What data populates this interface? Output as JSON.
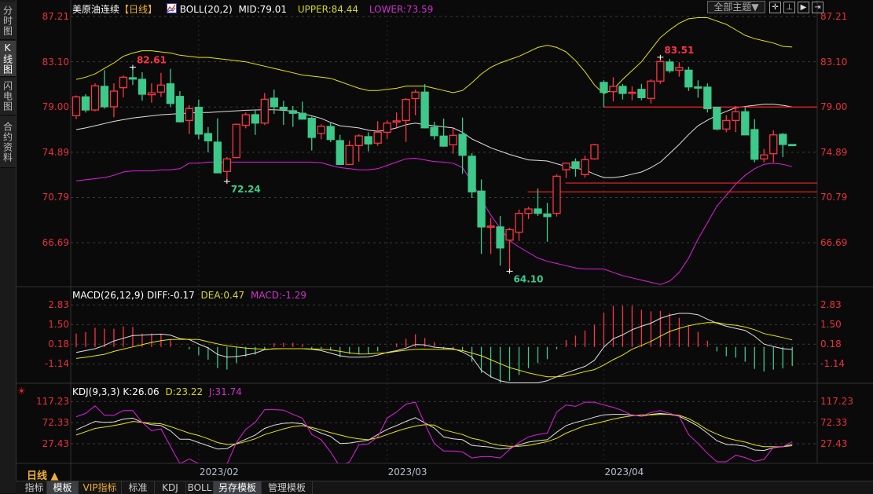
{
  "sidebar": {
    "tabs": [
      {
        "label": "分时图"
      },
      {
        "label": "K线图"
      },
      {
        "label": "闪电图"
      },
      {
        "label": "合约资料"
      }
    ]
  },
  "header": {
    "instrument": "美原油连续",
    "period_bracket_l": "【",
    "period": "日线",
    "period_bracket_r": "】",
    "boll_name": "BOLL(20,2)",
    "mid": "MID:79.01",
    "upper": "UPPER:84.44",
    "lower": "LOWER:73.59"
  },
  "toolbar": {
    "theme_select": "全部主题▼",
    "icons": [
      "crosshair-icon",
      "zoom-range-icon",
      "play-forward-icon",
      "move-right-icon"
    ]
  },
  "macd_header": {
    "name": "MACD(26,12,9)",
    "diff": "DIFF:-0.17",
    "dea": "DEA:0.47",
    "macd": "MACD:-1.29"
  },
  "kdj_header": {
    "name": "KDJ(9,3,3)",
    "k": "K:26.06",
    "d": "D:23.22",
    "j": "J:31.74"
  },
  "period_selector": "日线 ▲",
  "bottom_tabs": [
    {
      "label": "指标"
    },
    {
      "label": "模板"
    },
    {
      "label": "VIP指标"
    },
    {
      "label": "标准"
    },
    {
      "label": "KDJ"
    },
    {
      "label": "BOLL"
    },
    {
      "label": "另存模板"
    },
    {
      "label": "管理模板"
    }
  ],
  "colors": {
    "up": "#ff3344",
    "down": "#3cc98a",
    "axis": "#e8303c",
    "yellow": "#e6e600",
    "white": "#e0e0e0",
    "magenta": "#e020e0",
    "line": "#ff2020"
  },
  "chart_data": [
    {
      "type": "candlestick",
      "title": "美原油连续 日线 BOLL(20,2)",
      "yticks": [
        "87.21",
        "83.10",
        "79.00",
        "74.89",
        "70.79",
        "66.69"
      ],
      "ylim": [
        62.6,
        88.7
      ],
      "x_labels": [
        {
          "label": "2023/02",
          "candle": 13
        },
        {
          "label": "2023/03",
          "candle": 33
        },
        {
          "label": "2023/04",
          "candle": 56
        }
      ],
      "ohlc": [
        [
          78.21,
          80.04,
          77.9,
          79.92
        ],
        [
          79.92,
          80.16,
          78.5,
          78.73
        ],
        [
          78.73,
          81.15,
          78.61,
          80.92
        ],
        [
          80.87,
          82.34,
          78.85,
          79.02
        ],
        [
          79.02,
          81.15,
          78.07,
          80.44
        ],
        [
          80.75,
          81.87,
          79.87,
          81.7
        ],
        [
          81.65,
          82.61,
          80.99,
          81.53
        ],
        [
          81.51,
          82.15,
          79.56,
          80.16
        ],
        [
          80.11,
          81.15,
          79.39,
          80.28
        ],
        [
          80.35,
          82.1,
          79.92,
          80.99
        ],
        [
          81.1,
          82.46,
          79.02,
          79.32
        ],
        [
          79.96,
          80.44,
          77.59,
          77.66
        ],
        [
          77.78,
          79.16,
          76.54,
          78.85
        ],
        [
          78.97,
          79.68,
          76.07,
          76.54
        ],
        [
          76.59,
          77.18,
          74.88,
          75.93
        ],
        [
          75.81,
          77.97,
          73.03,
          73.03
        ],
        [
          73.15,
          74.46,
          72.24,
          74.29
        ],
        [
          74.41,
          77.5,
          74.34,
          77.43
        ],
        [
          77.33,
          78.5,
          77.07,
          78.3
        ],
        [
          78.3,
          78.73,
          76.47,
          77.54
        ],
        [
          77.54,
          80.28,
          77.36,
          79.7
        ],
        [
          79.8,
          80.58,
          78.37,
          79.02
        ],
        [
          78.97,
          79.56,
          77.38,
          78.78
        ],
        [
          78.66,
          79.09,
          77.19,
          78.43
        ],
        [
          78.43,
          79.49,
          77.88,
          77.9
        ],
        [
          77.97,
          78.14,
          75.05,
          76.24
        ],
        [
          76.6,
          77.43,
          76.07,
          77.26
        ],
        [
          77.23,
          77.59,
          75.81,
          76.05
        ],
        [
          75.95,
          76.47,
          73.79,
          73.79
        ],
        [
          73.79,
          75.95,
          73.79,
          75.5
        ],
        [
          75.5,
          76.52,
          74.05,
          76.38
        ],
        [
          76.31,
          76.71,
          74.98,
          75.65
        ],
        [
          75.72,
          77.71,
          75.48,
          76.71
        ],
        [
          76.71,
          77.78,
          76.12,
          77.54
        ],
        [
          77.66,
          78.5,
          77.14,
          77.74
        ],
        [
          77.78,
          79.8,
          75.83,
          79.68
        ],
        [
          79.77,
          80.58,
          78.25,
          80.35
        ],
        [
          80.35,
          81.08,
          77.07,
          77.11
        ],
        [
          77.16,
          77.66,
          76.05,
          76.4
        ],
        [
          76.36,
          77.95,
          75.4,
          75.45
        ],
        [
          75.57,
          77.07,
          74.76,
          76.43
        ],
        [
          76.52,
          78.04,
          72.94,
          74.62
        ],
        [
          74.53,
          74.81,
          70.75,
          71.3
        ],
        [
          71.37,
          72.43,
          65.67,
          68.12
        ],
        [
          68.1,
          68.94,
          65.67,
          68.2
        ],
        [
          68.12,
          69.11,
          64.61,
          66.21
        ],
        [
          66.92,
          68.04,
          64.1,
          67.87
        ],
        [
          67.64,
          69.7,
          66.85,
          69.35
        ],
        [
          69.35,
          69.94,
          68.83,
          69.75
        ],
        [
          69.75,
          71.6,
          69.11,
          69.35
        ],
        [
          69.3,
          70.3,
          66.78,
          69.06
        ],
        [
          69.35,
          72.91,
          69.06,
          72.72
        ],
        [
          73.31,
          73.86,
          72.55,
          73.9
        ],
        [
          74.03,
          74.34,
          72.68,
          73.43
        ],
        [
          72.87,
          74.58,
          72.6,
          74.22
        ],
        [
          74.29,
          75.65,
          74.22,
          75.57
        ],
        [
          81.23,
          81.42,
          78.97,
          80.32
        ],
        [
          80.39,
          81.7,
          79.51,
          80.87
        ],
        [
          80.87,
          81.1,
          79.68,
          80.23
        ],
        [
          80.3,
          80.87,
          79.61,
          80.34
        ],
        [
          80.6,
          81.1,
          79.61,
          79.85
        ],
        [
          79.78,
          81.51,
          79.32,
          81.35
        ],
        [
          81.35,
          83.51,
          81.1,
          83.13
        ],
        [
          83.08,
          83.36,
          82.1,
          82.29
        ],
        [
          82.34,
          83.06,
          81.75,
          82.58
        ],
        [
          82.34,
          82.65,
          80.46,
          80.82
        ],
        [
          80.82,
          81.42,
          79.85,
          80.75
        ],
        [
          80.8,
          81.15,
          78.5,
          78.85
        ],
        [
          78.97,
          79.02,
          76.88,
          77.0
        ],
        [
          77.0,
          78.25,
          76.71,
          77.78
        ],
        [
          77.78,
          79.09,
          76.71,
          78.57
        ],
        [
          78.57,
          78.97,
          76.47,
          76.47
        ],
        [
          76.95,
          77.9,
          73.98,
          74.26
        ],
        [
          74.29,
          75.2,
          73.98,
          74.65
        ],
        [
          74.76,
          76.88,
          73.98,
          76.47
        ],
        [
          76.52,
          76.64,
          74.46,
          75.6
        ],
        [
          75.6,
          75.6,
          75.55,
          75.55
        ]
      ],
      "boll_upper": [
        81.5,
        81.7,
        82.0,
        82.5,
        83.0,
        83.6,
        83.9,
        84.1,
        84.1,
        84.0,
        83.9,
        83.7,
        83.6,
        83.5,
        83.5,
        83.4,
        83.3,
        83.2,
        83.1,
        82.9,
        82.7,
        82.5,
        82.3,
        82.1,
        81.9,
        81.8,
        81.7,
        81.6,
        81.3,
        81.0,
        80.7,
        80.5,
        80.5,
        80.6,
        80.7,
        80.9,
        80.9,
        80.9,
        80.7,
        80.5,
        80.3,
        80.5,
        81.2,
        82.0,
        82.6,
        83.0,
        83.3,
        83.6,
        84.0,
        84.4,
        84.6,
        84.4,
        84.0,
        83.2,
        82.2,
        81.0,
        80.2,
        80.6,
        81.5,
        82.3,
        83.1,
        84.2,
        85.3,
        86.0,
        86.6,
        87.0,
        87.1,
        87.1,
        86.8,
        86.5,
        86.0,
        85.5,
        85.2,
        85.0,
        84.8,
        84.5,
        84.44
      ],
      "boll_mid": [
        76.95,
        77.1,
        77.3,
        77.5,
        77.7,
        77.85,
        78.0,
        78.1,
        78.2,
        78.3,
        78.35,
        78.4,
        78.45,
        78.5,
        78.5,
        78.55,
        78.6,
        78.65,
        78.7,
        78.73,
        78.75,
        78.75,
        78.7,
        78.6,
        78.4,
        78.2,
        77.97,
        77.6,
        77.3,
        77.2,
        77.1,
        76.9,
        76.8,
        76.9,
        77.1,
        77.4,
        77.54,
        77.4,
        77.3,
        77.2,
        77.1,
        76.7,
        76.1,
        75.7,
        75.3,
        75.0,
        74.7,
        74.45,
        74.2,
        74.15,
        74.1,
        73.85,
        73.6,
        73.45,
        73.3,
        72.9,
        72.6,
        72.6,
        72.7,
        72.9,
        73.1,
        73.5,
        74.0,
        74.8,
        75.6,
        76.5,
        77.3,
        77.8,
        78.25,
        78.6,
        78.94,
        79.05,
        79.15,
        79.25,
        79.25,
        79.15,
        79.01
      ],
      "boll_lower": [
        72.3,
        72.4,
        72.5,
        72.6,
        72.8,
        73.1,
        73.2,
        73.2,
        73.2,
        73.3,
        73.3,
        73.4,
        73.9,
        73.9,
        74.0,
        74.0,
        74.0,
        74.0,
        74.0,
        74.0,
        74.0,
        74.0,
        74.0,
        74.0,
        74.0,
        74.0,
        73.95,
        73.7,
        73.5,
        73.4,
        73.3,
        73.3,
        73.4,
        73.7,
        74.0,
        74.3,
        74.35,
        74.2,
        74.05,
        74.0,
        73.9,
        73.5,
        72.2,
        70.6,
        69.2,
        68.0,
        66.9,
        66.3,
        65.8,
        65.3,
        65.0,
        64.8,
        64.6,
        64.4,
        64.3,
        64.3,
        64.3,
        64.0,
        63.7,
        63.5,
        63.3,
        63.1,
        62.9,
        63.2,
        64.0,
        65.3,
        67.0,
        68.5,
        70.0,
        71.0,
        72.0,
        72.8,
        73.4,
        73.8,
        73.9,
        73.8,
        73.59
      ],
      "horizontal_lines": [
        {
          "price": 79.0,
          "from_candle": 56
        },
        {
          "price": 72.1,
          "from_candle": 52
        },
        {
          "price": 71.3,
          "from_candle": 48
        }
      ],
      "annotations": [
        {
          "label": "82.61",
          "candle": 6,
          "kind": "high"
        },
        {
          "label": "72.24",
          "candle": 16,
          "kind": "low"
        },
        {
          "label": "64.10",
          "candle": 46,
          "kind": "low"
        },
        {
          "label": "83.51",
          "candle": 62,
          "kind": "high"
        }
      ]
    },
    {
      "type": "bar+line",
      "title": "MACD(26,12,9)",
      "yticks": [
        "2.83",
        "1.50",
        "0.18",
        "-1.14"
      ],
      "macd": [
        0.9,
        1.0,
        1.29,
        1.22,
        1.22,
        1.38,
        1.34,
        0.9,
        0.9,
        0.85,
        0.5,
        0.02,
        -0.16,
        -0.56,
        -0.86,
        -1.43,
        -1.53,
        -1.09,
        -0.65,
        -0.51,
        -0.16,
        0.25,
        0.28,
        0.28,
        0.16,
        -0.16,
        -0.16,
        -0.25,
        -0.69,
        -0.48,
        -0.48,
        -0.48,
        -0.3,
        0.02,
        0.23,
        0.55,
        0.85,
        0.6,
        0.32,
        -0.12,
        -0.1,
        -0.25,
        -1.0,
        -1.75,
        -2.06,
        -2.42,
        -2.28,
        -1.89,
        -1.43,
        -1.09,
        -0.83,
        -0.16,
        0.46,
        0.76,
        1.11,
        1.48,
        2.31,
        2.77,
        2.77,
        2.77,
        2.5,
        2.4,
        2.43,
        2.26,
        1.96,
        1.43,
        1.02,
        0.42,
        -0.3,
        -0.63,
        -0.72,
        -1.0,
        -1.48,
        -1.66,
        -1.53,
        -1.45,
        -1.29
      ],
      "diff": [
        -0.37,
        -0.25,
        -0.12,
        0.1,
        0.4,
        0.58,
        0.76,
        0.79,
        0.83,
        0.86,
        0.79,
        0.56,
        0.49,
        0.19,
        -0.07,
        -0.51,
        -0.69,
        -0.65,
        -0.55,
        -0.42,
        -0.19,
        -0.12,
        -0.12,
        -0.12,
        -0.12,
        -0.16,
        -0.25,
        -0.42,
        -0.6,
        -0.69,
        -0.69,
        -0.67,
        -0.55,
        -0.37,
        -0.25,
        -0.09,
        0.16,
        0.14,
        -0.02,
        -0.07,
        -0.12,
        -0.34,
        -0.69,
        -1.57,
        -2.01,
        -2.28,
        -2.42,
        -2.42,
        -2.42,
        -2.42,
        -2.28,
        -2.01,
        -1.75,
        -1.53,
        -1.31,
        -0.9,
        -0.02,
        0.55,
        0.81,
        1.16,
        1.39,
        1.6,
        1.92,
        2.13,
        2.26,
        2.26,
        2.17,
        1.87,
        1.6,
        1.39,
        1.25,
        1.11,
        0.72,
        0.19,
        0.02,
        -0.12,
        -0.17
      ],
      "dea": [
        -0.78,
        -0.7,
        -0.6,
        -0.5,
        -0.3,
        -0.15,
        0.0,
        0.15,
        0.3,
        0.42,
        0.5,
        0.51,
        0.51,
        0.5,
        0.35,
        0.2,
        0.08,
        0.0,
        -0.08,
        -0.12,
        -0.16,
        -0.14,
        -0.12,
        -0.12,
        -0.12,
        -0.13,
        -0.15,
        -0.2,
        -0.3,
        -0.4,
        -0.48,
        -0.47,
        -0.43,
        -0.4,
        -0.3,
        -0.22,
        -0.16,
        -0.15,
        -0.16,
        -0.16,
        -0.17,
        -0.25,
        -0.42,
        -0.6,
        -0.86,
        -1.13,
        -1.39,
        -1.57,
        -1.75,
        -1.89,
        -2.01,
        -2.01,
        -1.96,
        -1.83,
        -1.66,
        -1.53,
        -1.22,
        -0.86,
        -0.55,
        -0.16,
        0.1,
        0.37,
        0.72,
        1.04,
        1.25,
        1.43,
        1.55,
        1.64,
        1.64,
        1.52,
        1.46,
        1.34,
        1.16,
        0.9,
        0.76,
        0.63,
        0.47
      ]
    },
    {
      "type": "line",
      "title": "KDJ(9,3,3)",
      "yticks": [
        "117.23",
        "72.33",
        "27.43"
      ],
      "k": [
        57,
        66,
        75,
        73,
        74,
        80,
        82,
        73,
        68,
        66,
        55,
        37,
        37,
        30,
        23,
        16,
        17,
        28,
        37,
        46,
        60,
        67,
        71,
        72,
        70,
        59,
        50,
        43,
        28,
        29,
        32,
        35,
        47,
        58,
        66,
        75,
        83,
        72,
        61,
        42,
        38,
        36,
        24,
        22,
        20,
        16,
        18,
        25,
        31,
        34,
        36,
        52,
        66,
        73,
        78,
        84,
        89,
        90,
        90,
        89,
        86,
        90,
        92,
        90,
        86,
        76,
        65,
        50,
        34,
        26,
        25,
        22,
        14,
        13,
        19,
        21,
        26.06
      ],
      "d": [
        46,
        53,
        60,
        63,
        66,
        70,
        75,
        73,
        71,
        70,
        64,
        57,
        50,
        45,
        38,
        30,
        26,
        27,
        32,
        38,
        47,
        53,
        59,
        64,
        66,
        62,
        57,
        51,
        46,
        41,
        38,
        36,
        40,
        47,
        54,
        60,
        65,
        68,
        67,
        57,
        52,
        47,
        39,
        35,
        28,
        24,
        22,
        22,
        24,
        28,
        32,
        39,
        50,
        58,
        66,
        70,
        75,
        80,
        84,
        87,
        89,
        89,
        90,
        90,
        88,
        81,
        70,
        57,
        48,
        40,
        35,
        31,
        25,
        21,
        21,
        21,
        23.22
      ],
      "j": [
        85,
        92,
        108,
        88,
        88,
        98,
        98,
        73,
        55,
        59,
        22,
        -15,
        -5,
        -15,
        -18,
        -24,
        -16,
        30,
        58,
        73,
        100,
        100,
        99,
        90,
        82,
        47,
        36,
        10,
        -22,
        -11,
        25,
        27,
        42,
        82,
        95,
        112,
        116,
        70,
        28,
        12,
        12,
        10,
        -3,
        0,
        0,
        -3,
        15,
        30,
        42,
        47,
        50,
        95,
        110,
        107,
        116,
        116,
        110,
        105,
        98,
        88,
        86,
        94,
        98,
        92,
        86,
        47,
        28,
        7,
        -11,
        -11,
        3,
        -2,
        -10,
        -6,
        20,
        21,
        31.74
      ]
    }
  ]
}
